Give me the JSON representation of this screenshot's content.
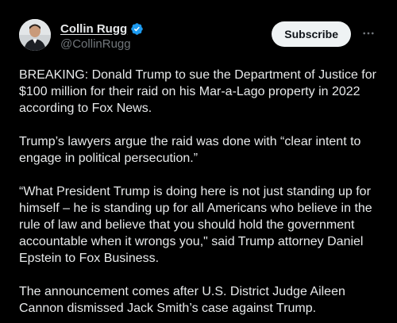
{
  "author": {
    "display_name": "Collin Rugg",
    "handle": "@CollinRugg",
    "verified": true
  },
  "actions": {
    "subscribe_label": "Subscribe",
    "more_icon": "more-dots-icon"
  },
  "colors": {
    "background": "#000000",
    "text": "#e7e9ea",
    "secondary_text": "#71767b",
    "verified_blue": "#1d9bf0",
    "subscribe_bg": "#eff3f4"
  },
  "tweet": {
    "paragraphs": [
      "BREAKING: Donald Trump to sue the Department of Justice for $100 million for their raid on his Mar-a-Lago property in 2022 according to Fox News.",
      "Trump’s lawyers argue the raid was done with “clear intent to engage in political persecution.”",
      "“What President Trump is doing here is not just standing up for himself – he is standing up for all Americans who believe in the rule of law and believe that you should hold the government accountable when it wrongs you,\" said Trump attorney Daniel Epstein to Fox Business.",
      "The announcement comes after U.S. District Judge Aileen Cannon dismissed Jack Smith’s case against Trump."
    ]
  }
}
